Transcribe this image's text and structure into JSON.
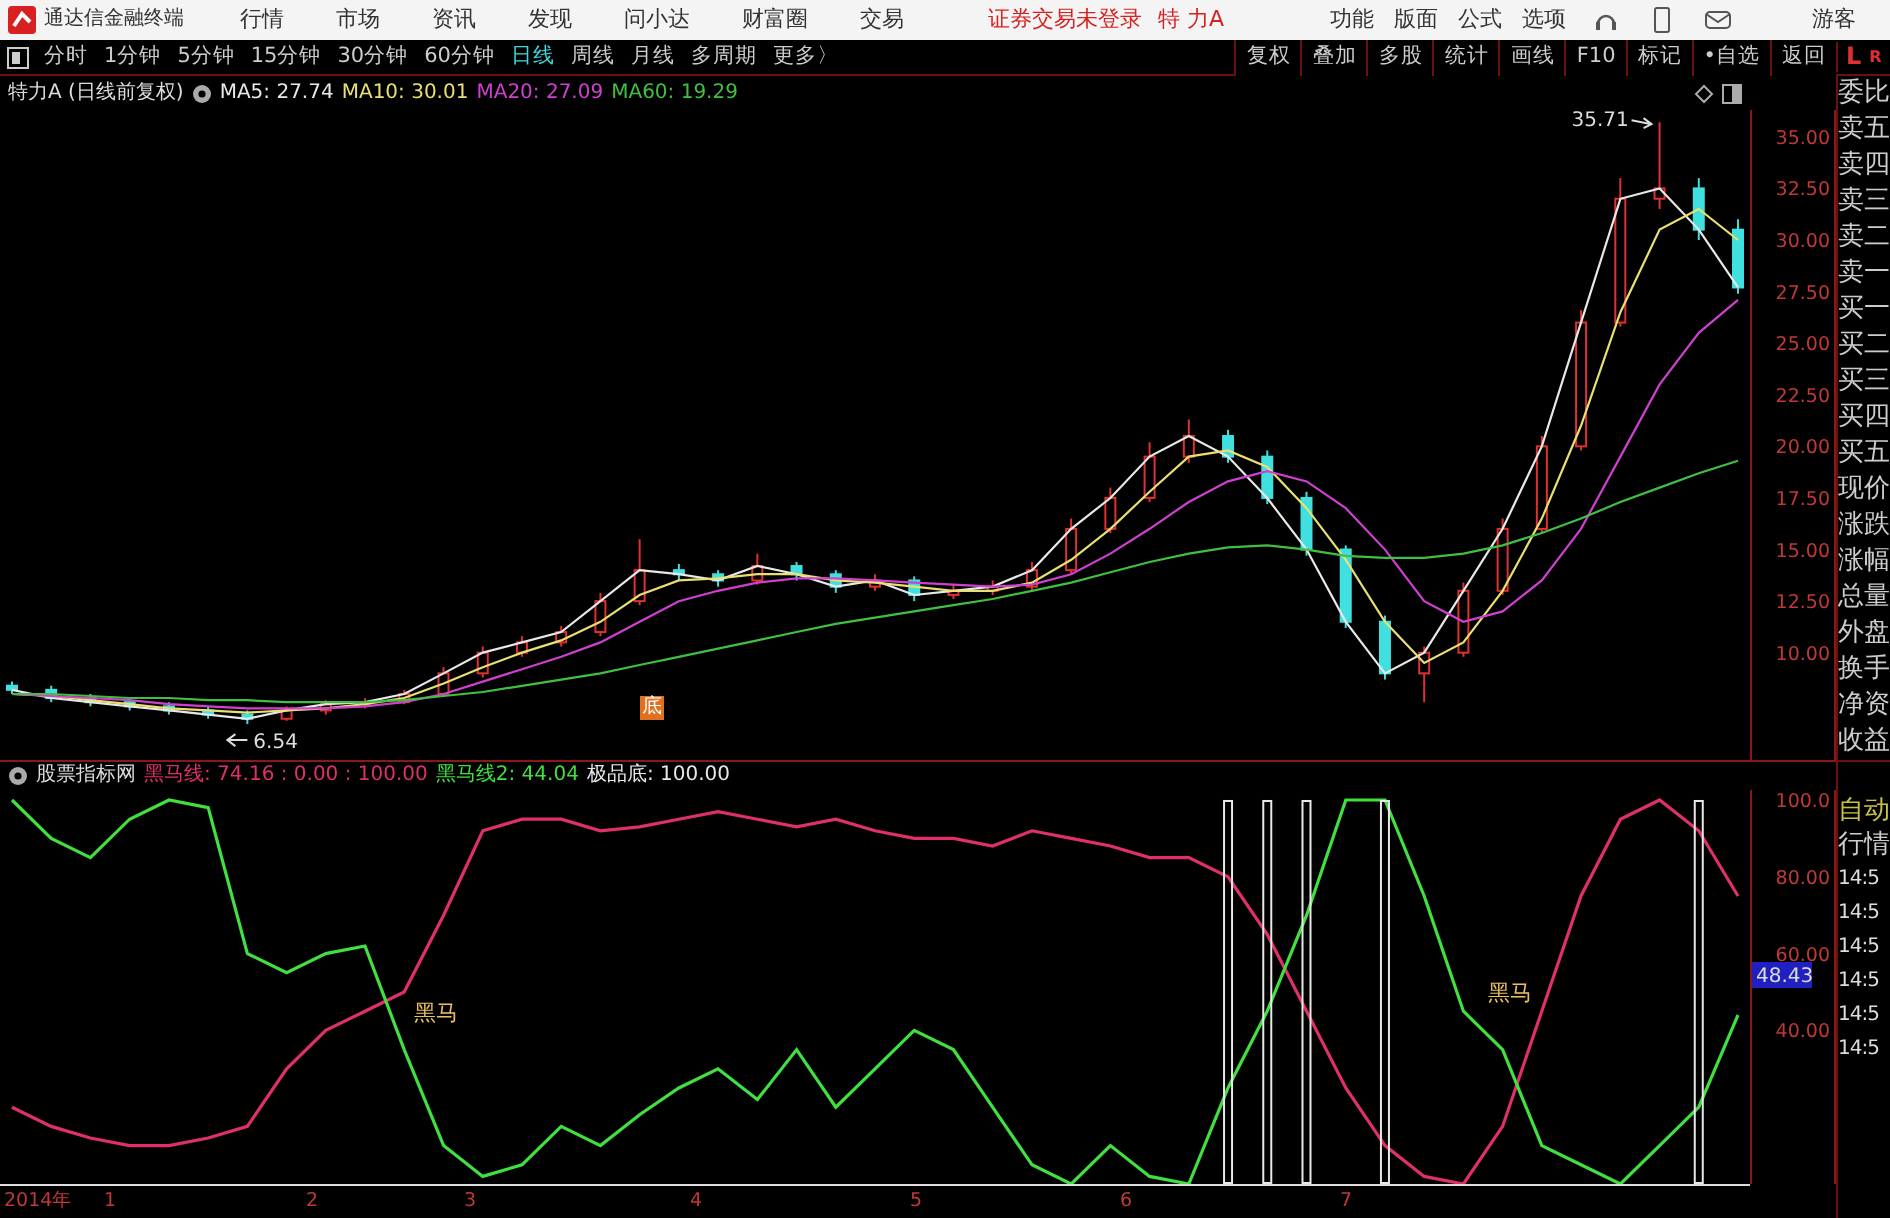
{
  "menu_bar": {
    "app_title": "通达信金融终端",
    "menus": [
      "行情",
      "市场",
      "资讯",
      "发现",
      "问小达",
      "财富圈",
      "交易"
    ],
    "login_status": "证券交易未登录",
    "stock_name": "特 力A",
    "tools": [
      "功能",
      "版面",
      "公式",
      "选项"
    ],
    "user": "游客"
  },
  "period_tabs": [
    {
      "label": "分时",
      "selected": false
    },
    {
      "label": "1分钟",
      "selected": false
    },
    {
      "label": "5分钟",
      "selected": false
    },
    {
      "label": "15分钟",
      "selected": false
    },
    {
      "label": "30分钟",
      "selected": false
    },
    {
      "label": "60分钟",
      "selected": false
    },
    {
      "label": "日线",
      "selected": true
    },
    {
      "label": "周线",
      "selected": false
    },
    {
      "label": "月线",
      "selected": false
    },
    {
      "label": "多周期",
      "selected": false
    },
    {
      "label": "更多〉",
      "selected": false
    }
  ],
  "chart_tools": [
    "复权",
    "叠加",
    "多股",
    "统计",
    "画线",
    "F10",
    "标记",
    "•自选",
    "返回"
  ],
  "quote_tabs": [
    "L",
    "R"
  ],
  "price_pane": {
    "title": "特力A (日线前复权)",
    "signal_marker": "底",
    "chart_data": {
      "type": "candlestick",
      "ylim": [
        4.8,
        36.3
      ],
      "yticks": [
        {
          "value": 35,
          "label": "35.00"
        },
        {
          "value": 32.5,
          "label": "32.50"
        },
        {
          "value": 30,
          "label": "30.00"
        },
        {
          "value": 27.5,
          "label": "27.50"
        },
        {
          "value": 25,
          "label": "25.00"
        },
        {
          "value": 22.5,
          "label": "22.50"
        },
        {
          "value": 20,
          "label": "20.00"
        },
        {
          "value": 17.5,
          "label": "17.50"
        },
        {
          "value": 15,
          "label": "15.00"
        },
        {
          "value": 12.5,
          "label": "12.50"
        },
        {
          "value": 10,
          "label": "10.00"
        }
      ],
      "ohlc": [
        [
          8.4,
          8.6,
          8.0,
          8.2
        ],
        [
          8.2,
          8.4,
          7.6,
          7.8
        ],
        [
          7.8,
          8.0,
          7.4,
          7.6
        ],
        [
          7.6,
          7.8,
          7.2,
          7.4
        ],
        [
          7.4,
          7.6,
          7.0,
          7.2
        ],
        [
          7.2,
          7.4,
          6.8,
          7.0
        ],
        [
          7.0,
          7.2,
          6.54,
          6.8
        ],
        [
          6.8,
          7.4,
          6.7,
          7.2
        ],
        [
          7.2,
          7.7,
          7.0,
          7.5
        ],
        [
          7.5,
          7.8,
          7.3,
          7.6
        ],
        [
          7.6,
          8.2,
          7.5,
          8.0
        ],
        [
          8.0,
          9.3,
          7.9,
          9.0
        ],
        [
          9.0,
          10.3,
          8.8,
          10.0
        ],
        [
          10.0,
          10.8,
          9.8,
          10.5
        ],
        [
          10.5,
          11.3,
          10.3,
          11.0
        ],
        [
          11.0,
          12.9,
          10.8,
          12.5
        ],
        [
          12.5,
          15.5,
          12.3,
          14.0
        ],
        [
          14.0,
          14.3,
          13.5,
          13.8
        ],
        [
          13.8,
          14.0,
          13.2,
          13.5
        ],
        [
          13.5,
          14.8,
          13.3,
          14.2
        ],
        [
          14.2,
          14.4,
          13.5,
          13.8
        ],
        [
          13.8,
          14.0,
          12.9,
          13.2
        ],
        [
          13.2,
          13.8,
          13.0,
          13.5
        ],
        [
          13.5,
          13.7,
          12.5,
          12.8
        ],
        [
          12.8,
          13.3,
          12.6,
          13.0
        ],
        [
          13.0,
          13.5,
          12.8,
          13.2
        ],
        [
          13.2,
          14.4,
          13.0,
          14.0
        ],
        [
          14.0,
          16.5,
          13.8,
          16.0
        ],
        [
          16.0,
          18.0,
          15.8,
          17.5
        ],
        [
          17.5,
          20.2,
          17.3,
          19.5
        ],
        [
          19.5,
          21.3,
          19.2,
          20.5
        ],
        [
          20.5,
          20.8,
          19.2,
          19.5
        ],
        [
          19.5,
          19.8,
          17.2,
          17.5
        ],
        [
          17.5,
          17.8,
          14.7,
          15.0
        ],
        [
          15.0,
          15.2,
          11.2,
          11.5
        ],
        [
          11.5,
          11.8,
          8.7,
          9.0
        ],
        [
          9.0,
          10.3,
          7.6,
          10.0
        ],
        [
          10.0,
          13.4,
          9.8,
          13.0
        ],
        [
          13.0,
          16.5,
          12.8,
          16.0
        ],
        [
          16.0,
          20.5,
          15.8,
          20.0
        ],
        [
          20.0,
          26.6,
          19.8,
          26.0
        ],
        [
          26.0,
          33.0,
          25.8,
          32.0
        ],
        [
          32.0,
          35.71,
          31.5,
          32.5
        ],
        [
          32.5,
          33.0,
          30.0,
          30.5
        ],
        [
          30.5,
          31.0,
          27.4,
          27.7
        ]
      ],
      "series": [
        {
          "name": "MA5: 27.74",
          "color": "#e8e8e8",
          "type": "line",
          "values": [
            8.2,
            7.8,
            7.6,
            7.4,
            7.2,
            7.0,
            6.8,
            7.2,
            7.5,
            7.6,
            8.0,
            9.0,
            10.0,
            10.5,
            11.0,
            12.5,
            14.0,
            13.8,
            13.5,
            14.2,
            13.8,
            13.2,
            13.5,
            12.8,
            13.0,
            13.2,
            14.0,
            16.0,
            17.5,
            19.5,
            20.5,
            19.5,
            17.5,
            15.0,
            11.5,
            9.0,
            10.0,
            13.0,
            16.0,
            20.0,
            26.0,
            32.0,
            32.5,
            30.5,
            27.7
          ]
        },
        {
          "name": "MA10: 30.01",
          "color": "#e8e070",
          "type": "line",
          "values": [
            8.0,
            7.9,
            7.7,
            7.5,
            7.3,
            7.2,
            7.1,
            7.2,
            7.3,
            7.5,
            7.8,
            8.5,
            9.3,
            10.0,
            10.6,
            11.5,
            12.8,
            13.5,
            13.6,
            13.8,
            13.8,
            13.5,
            13.4,
            13.2,
            13.0,
            13.0,
            13.4,
            14.5,
            16.0,
            17.8,
            19.5,
            19.8,
            19.0,
            17.0,
            14.5,
            11.5,
            9.5,
            10.5,
            13.0,
            16.5,
            21.0,
            26.5,
            30.5,
            31.5,
            30.0
          ]
        },
        {
          "name": "MA20: 27.09",
          "color": "#d040d0",
          "type": "line",
          "values": [
            8.0,
            7.9,
            7.8,
            7.7,
            7.5,
            7.4,
            7.3,
            7.3,
            7.3,
            7.4,
            7.6,
            8.0,
            8.6,
            9.2,
            9.8,
            10.5,
            11.5,
            12.5,
            13.0,
            13.4,
            13.6,
            13.6,
            13.5,
            13.4,
            13.3,
            13.2,
            13.3,
            13.8,
            14.8,
            16.0,
            17.3,
            18.3,
            18.8,
            18.3,
            17.0,
            15.0,
            12.5,
            11.5,
            12.0,
            13.5,
            16.0,
            19.5,
            23.0,
            25.5,
            27.1
          ]
        },
        {
          "name": "MA60: 19.29",
          "color": "#40c040",
          "type": "line",
          "values": [
            8.0,
            8.0,
            7.9,
            7.8,
            7.8,
            7.7,
            7.7,
            7.6,
            7.6,
            7.6,
            7.7,
            7.9,
            8.1,
            8.4,
            8.7,
            9.0,
            9.4,
            9.8,
            10.2,
            10.6,
            11.0,
            11.4,
            11.7,
            12.0,
            12.3,
            12.6,
            13.0,
            13.4,
            13.9,
            14.4,
            14.8,
            15.1,
            15.2,
            15.0,
            14.7,
            14.6,
            14.6,
            14.8,
            15.2,
            15.8,
            16.5,
            17.3,
            18.0,
            18.7,
            19.3
          ]
        }
      ],
      "annotations": [
        "35.71",
        "6.54"
      ]
    }
  },
  "indicator_pane": {
    "title": "股票指标网",
    "current_value": "48.43",
    "signal_labels": [
      "黑马",
      "黑马"
    ],
    "chart_data": {
      "type": "line",
      "ylim": [
        0,
        102.6
      ],
      "yticks": [
        {
          "value": 100,
          "label": "100.0"
        },
        {
          "value": 80,
          "label": "80.00"
        },
        {
          "value": 60,
          "label": "60.00"
        },
        {
          "value": 40,
          "label": "40.00"
        }
      ],
      "series": [
        {
          "name": "黑马线: 74.16 : 0.00 : 100.00",
          "color": "#e0306a",
          "type": "line",
          "values": [
            20,
            15,
            12,
            10,
            10,
            12,
            15,
            30,
            40,
            45,
            50,
            70,
            92,
            95,
            95,
            92,
            93,
            95,
            97,
            95,
            93,
            95,
            92,
            90,
            90,
            88,
            92,
            90,
            88,
            85,
            85,
            80,
            65,
            45,
            25,
            10,
            2,
            0,
            15,
            45,
            75,
            95,
            100,
            92,
            75
          ]
        },
        {
          "name": "黑马线2: 44.04",
          "color": "#40e040",
          "type": "line",
          "values": [
            100,
            90,
            85,
            95,
            100,
            98,
            60,
            55,
            60,
            62,
            35,
            10,
            2,
            5,
            15,
            10,
            18,
            25,
            30,
            22,
            35,
            20,
            30,
            40,
            35,
            20,
            5,
            0,
            10,
            2,
            0,
            25,
            45,
            70,
            100,
            100,
            75,
            45,
            35,
            10,
            5,
            0,
            10,
            20,
            44
          ]
        },
        {
          "name": "极品底: 100.00",
          "color": "#e8e8e8",
          "type": "bar",
          "values": [
            0,
            0,
            0,
            0,
            0,
            0,
            0,
            0,
            0,
            0,
            0,
            0,
            0,
            0,
            0,
            0,
            0,
            0,
            0,
            0,
            0,
            0,
            0,
            0,
            0,
            0,
            0,
            0,
            0,
            0,
            0,
            100,
            100,
            100,
            0,
            100,
            0,
            0,
            0,
            0,
            0,
            0,
            0,
            100,
            0
          ]
        }
      ]
    }
  },
  "date_axis": [
    "2014年",
    "1",
    "2",
    "3",
    "4",
    "5",
    "6",
    "7"
  ],
  "quote_panel": {
    "fields": [
      "委比",
      "卖五",
      "卖四",
      "卖三",
      "卖二",
      "卖一",
      "买一",
      "买二",
      "买三",
      "买四",
      "买五",
      "现价",
      "涨跌",
      "涨幅",
      "总量",
      "外盘",
      "换手",
      "净资",
      "收益"
    ],
    "tabs": [
      "自动",
      "行情"
    ],
    "times": [
      "14:5",
      "14:5",
      "14:5",
      "14:5",
      "14:5",
      "14:5"
    ]
  }
}
